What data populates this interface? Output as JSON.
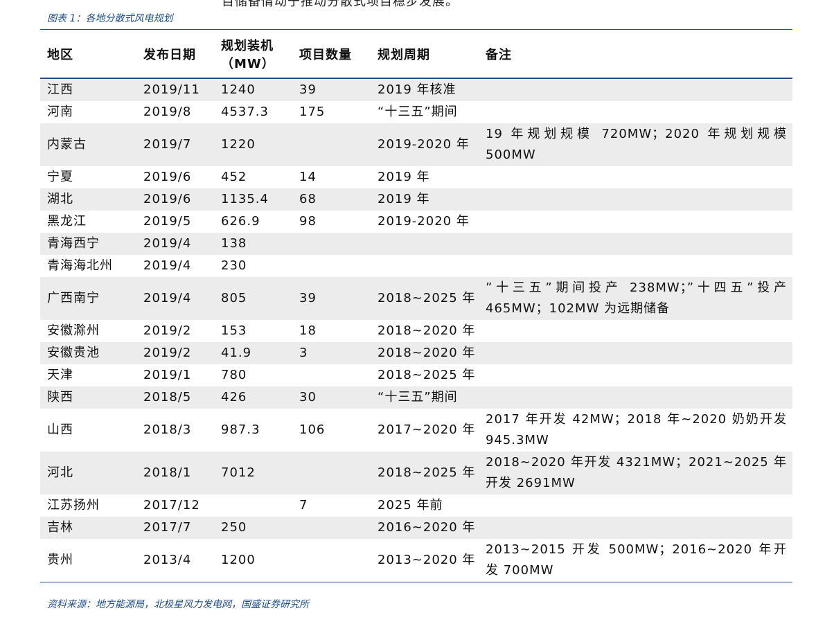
{
  "top_text": "目储备情动于推动分散式项目稳步发展。",
  "caption": "图表 1：各地分散式风电规划",
  "headers": [
    "地区",
    "发布日期",
    "规划装机（MW）",
    "项目数量",
    "规划周期",
    "备注"
  ],
  "header_parts": {
    "capacity_line1": "规划装机",
    "capacity_line2": "（MW）"
  },
  "rows": [
    {
      "region": "江西",
      "date": "2019/11",
      "capacity": "1240",
      "count": "39",
      "period": "2019 年核准",
      "note": ""
    },
    {
      "region": "河南",
      "date": "2019/8",
      "capacity": "4537.3",
      "count": "175",
      "period": "“十三五”期间",
      "note": ""
    },
    {
      "region": "内蒙古",
      "date": "2019/7",
      "capacity": "1220",
      "count": "",
      "period": "2019-2020 年",
      "note": "19 年规划规模 720MW；2020 年规划规模 500MW"
    },
    {
      "region": "宁夏",
      "date": "2019/6",
      "capacity": "452",
      "count": "14",
      "period": "2019 年",
      "note": ""
    },
    {
      "region": "湖北",
      "date": "2019/6",
      "capacity": "1135.4",
      "count": "68",
      "period": "2019 年",
      "note": ""
    },
    {
      "region": "黑龙江",
      "date": "2019/5",
      "capacity": "626.9",
      "count": "98",
      "period": "2019-2020 年",
      "note": ""
    },
    {
      "region": "青海西宁",
      "date": "2019/4",
      "capacity": "138",
      "count": "",
      "period": "",
      "note": ""
    },
    {
      "region": "青海海北州",
      "date": "2019/4",
      "capacity": "230",
      "count": "",
      "period": "",
      "note": ""
    },
    {
      "region": "广西南宁",
      "date": "2019/4",
      "capacity": "805",
      "count": "39",
      "period": "2018~2025 年",
      "note": "”十三五”期间投产 238MW；”十四五”投产 465MW；102MW 为远期储备"
    },
    {
      "region": "安徽滁州",
      "date": "2019/2",
      "capacity": "153",
      "count": "18",
      "period": "2018~2020 年",
      "note": ""
    },
    {
      "region": "安徽贵池",
      "date": "2019/2",
      "capacity": "41.9",
      "count": "3",
      "period": "2018~2020 年",
      "note": ""
    },
    {
      "region": "天津",
      "date": "2019/1",
      "capacity": "780",
      "count": "",
      "period": "2018~2025 年",
      "note": ""
    },
    {
      "region": "陕西",
      "date": "2018/5",
      "capacity": "426",
      "count": "30",
      "period": "“十三五”期间",
      "note": ""
    },
    {
      "region": "山西",
      "date": "2018/3",
      "capacity": "987.3",
      "count": "106",
      "period": "2017~2020 年",
      "note": "2017 年开发 42MW；2018 年~2020 奶奶开发 945.3MW"
    },
    {
      "region": "河北",
      "date": "2018/1",
      "capacity": "7012",
      "count": "",
      "period": "2018~2025 年",
      "note": "2018~2020 年开发 4321MW；2021~2025 年开发 2691MW"
    },
    {
      "region": "江苏扬州",
      "date": "2017/12",
      "capacity": "",
      "count": "7",
      "period": "2025 年前",
      "note": ""
    },
    {
      "region": "吉林",
      "date": "2017/7",
      "capacity": "250",
      "count": "",
      "period": "2016~2020 年",
      "note": ""
    },
    {
      "region": "贵州",
      "date": "2013/4",
      "capacity": "1200",
      "count": "",
      "period": "2013~2020 年",
      "note": "2013~2015 开发 500MW；2016~2020 年开发 700MW"
    }
  ],
  "source": "资料来源：地方能源局，北极星风力发电网，国盛证券研究所",
  "colors": {
    "accent": "#1f4e8c",
    "row_shade": "#ececec"
  }
}
